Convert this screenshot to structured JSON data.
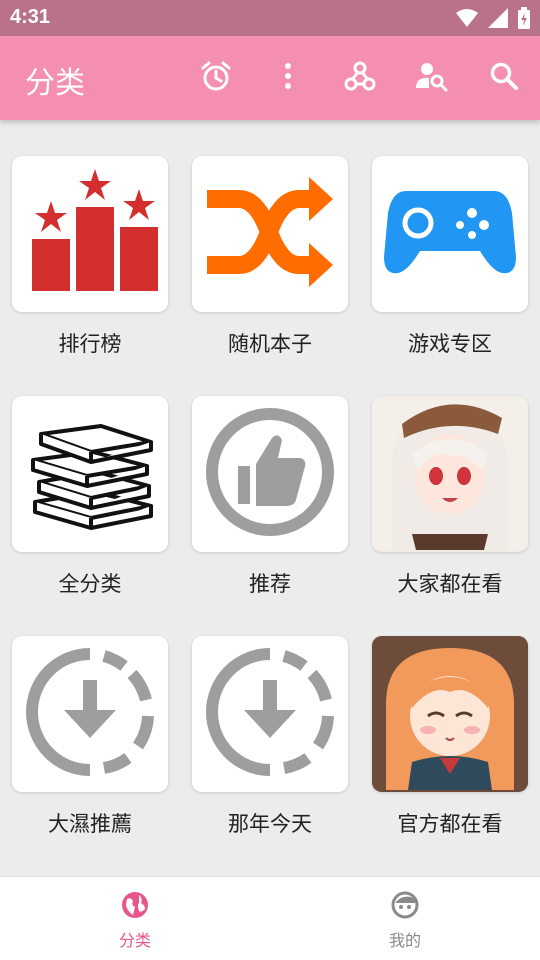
{
  "status_bar": {
    "time": "4:31"
  },
  "app_bar": {
    "title": "分类",
    "actions": [
      "alarm-icon",
      "more-vert-icon",
      "webhook-icon",
      "person-search-icon",
      "search-icon"
    ]
  },
  "tiles": [
    {
      "label": "排行榜",
      "icon": "ranking-icon"
    },
    {
      "label": "随机本子",
      "icon": "shuffle-icon"
    },
    {
      "label": "游戏专区",
      "icon": "gamepad-icon"
    },
    {
      "label": "全分类",
      "icon": "books-icon"
    },
    {
      "label": "推荐",
      "icon": "thumbs-up-icon"
    },
    {
      "label": "大家都在看",
      "icon": "anime-girl-white-hair-image"
    },
    {
      "label": "大濕推薦",
      "icon": "download-progress-icon"
    },
    {
      "label": "那年今天",
      "icon": "download-progress-icon"
    },
    {
      "label": "官方都在看",
      "icon": "anime-girl-orange-hair-image"
    }
  ],
  "bottom_nav": [
    {
      "label": "分类",
      "icon": "globe-icon",
      "active": true
    },
    {
      "label": "我的",
      "icon": "face-icon",
      "active": false
    }
  ],
  "colors": {
    "status_bar": "#b97289",
    "app_bar": "#f48fb1",
    "accent": "#e8578a",
    "inactive": "#8a8a8a"
  }
}
